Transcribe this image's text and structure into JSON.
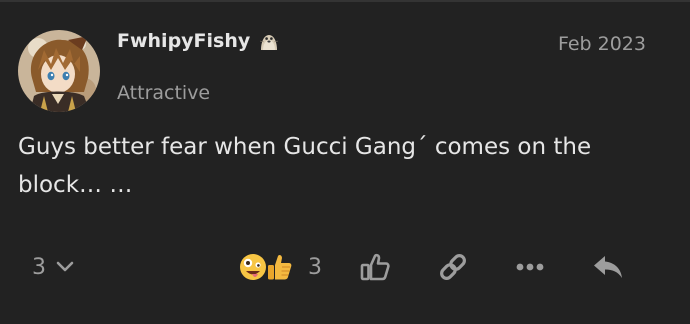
{
  "post": {
    "username": "FwhipyFishy",
    "flair_icon": "seal-icon",
    "date": "Feb 2023",
    "user_title": "Attractive",
    "body_line_1": "Guys better fear when Gucci Gang´ comes on the",
    "body_line_2": "block… …"
  },
  "footer": {
    "replies_count": "3",
    "replies_icon": "chevron-down-icon",
    "reaction_emojis": [
      "zany-face-emoji",
      "thumbs-up-emoji"
    ],
    "reaction_count": "3",
    "actions": [
      "like-icon",
      "link-icon",
      "more-icon",
      "reply-icon"
    ]
  },
  "colors": {
    "background": "#222222",
    "text_primary": "#e6e6e6",
    "text_muted": "#9d9d9d"
  }
}
